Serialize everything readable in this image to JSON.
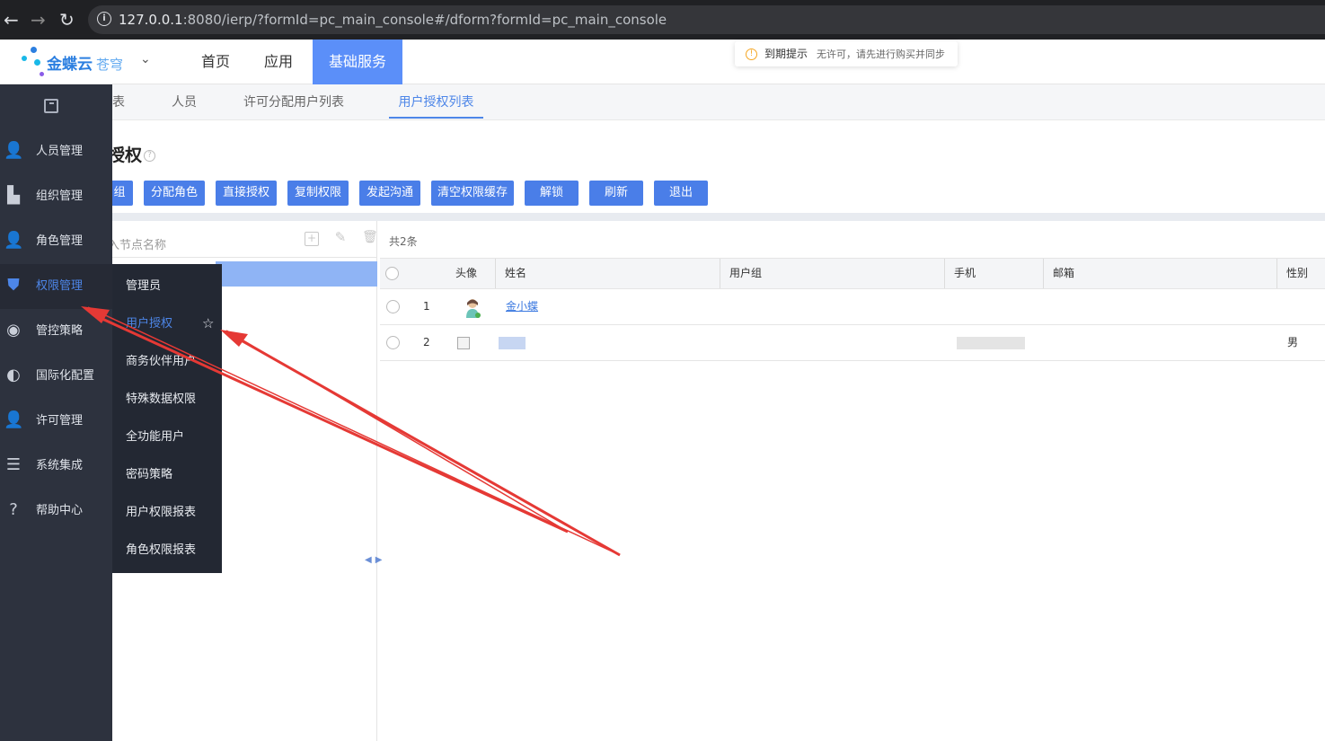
{
  "browser": {
    "url_host": "127.0.0.1",
    "url_rest": ":8080/ierp/?formId=pc_main_console#/dform?formId=pc_main_console"
  },
  "header": {
    "brand": "金蝶云",
    "brand_sub": "苍穹",
    "nav": [
      "首页",
      "应用",
      "基础服务"
    ],
    "expire_title": "到期提示",
    "expire_msg": "无许可，请先进行购买并同步"
  },
  "tabs": [
    "表",
    "人员",
    "许可分配用户列表",
    "用户授权列表"
  ],
  "page": {
    "title": "授权",
    "buttons": [
      "组",
      "分配角色",
      "直接授权",
      "复制权限",
      "发起沟通",
      "清空权限缓存",
      "解锁",
      "刷新",
      "退出"
    ]
  },
  "tree": {
    "search_placeholder": "入节点名称"
  },
  "grid": {
    "count": "共2条",
    "columns": [
      "头像",
      "姓名",
      "用户组",
      "手机",
      "邮箱",
      "性别"
    ],
    "rows": [
      {
        "index": "1",
        "name": "金小蝶",
        "gender": ""
      },
      {
        "index": "2",
        "name": "",
        "gender": "男"
      }
    ]
  },
  "sidebar": {
    "items": [
      {
        "label": "人员管理",
        "icon": "person-icon"
      },
      {
        "label": "组织管理",
        "icon": "org-icon"
      },
      {
        "label": "角色管理",
        "icon": "role-icon"
      },
      {
        "label": "权限管理",
        "icon": "shield-icon"
      },
      {
        "label": "管控策略",
        "icon": "compass-icon"
      },
      {
        "label": "国际化配置",
        "icon": "globe-icon"
      },
      {
        "label": "许可管理",
        "icon": "license-icon"
      },
      {
        "label": "系统集成",
        "icon": "server-icon"
      },
      {
        "label": "帮助中心",
        "icon": "help-icon"
      }
    ]
  },
  "submenu": {
    "items": [
      "管理员",
      "用户授权",
      "商务伙伴用户",
      "特殊数据权限",
      "全功能用户",
      "密码策略",
      "用户权限报表",
      "角色权限报表"
    ]
  },
  "colors": {
    "accent": "#4a7ee8",
    "sidebar_bg": "#2d323e",
    "annotation": "#e53935"
  }
}
